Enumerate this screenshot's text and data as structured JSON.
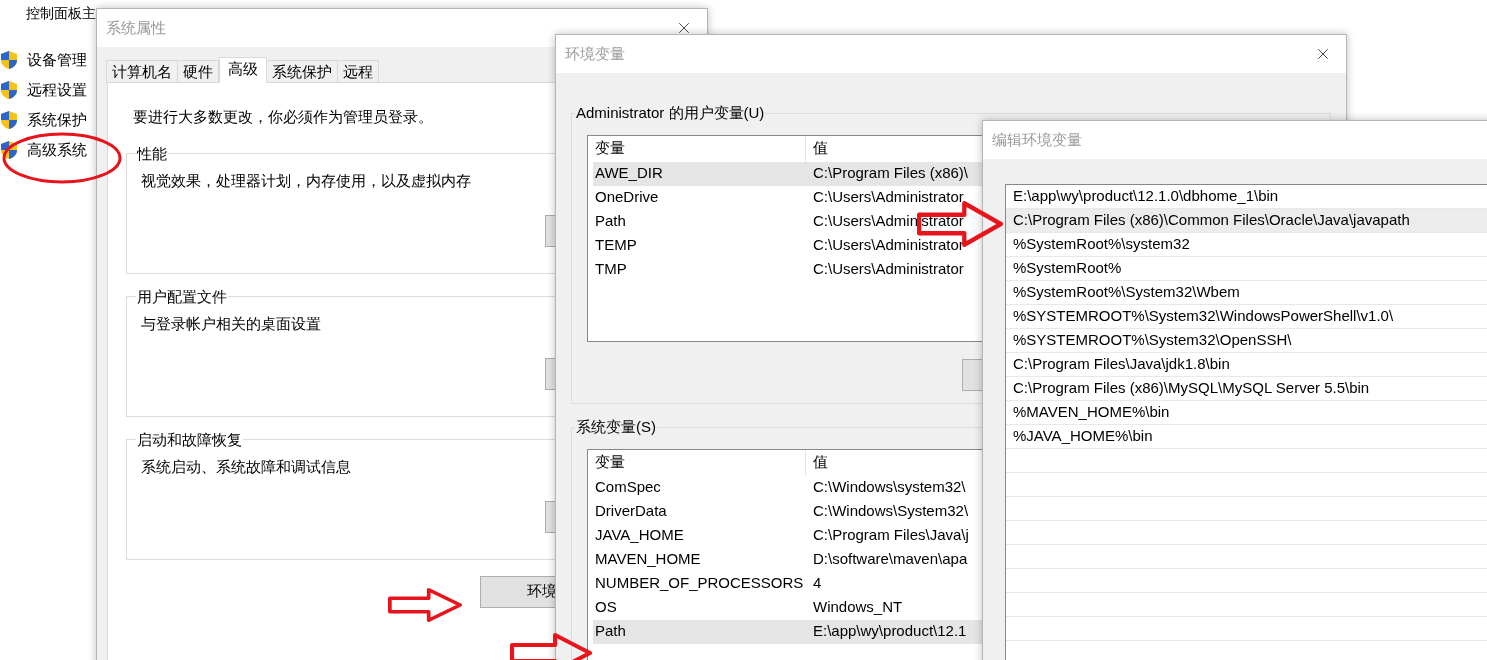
{
  "control_panel": {
    "home_link": "控制面板主",
    "items": [
      {
        "label": "设备管理"
      },
      {
        "label": "远程设置"
      },
      {
        "label": "系统保护"
      },
      {
        "label": "高级系统"
      }
    ]
  },
  "system_properties": {
    "title": "系统属性",
    "tabs": [
      {
        "label": "计算机名",
        "selected": false
      },
      {
        "label": "硬件",
        "selected": false
      },
      {
        "label": "高级",
        "selected": true
      },
      {
        "label": "系统保护",
        "selected": false
      },
      {
        "label": "远程",
        "selected": false
      }
    ],
    "notice": "要进行大多数更改，你必须作为管理员登录。",
    "groups": [
      {
        "title": "性能",
        "description": "视觉效果，处理器计划，内存使用，以及虚拟内存"
      },
      {
        "title": "用户配置文件",
        "description": "与登录帐户相关的桌面设置"
      },
      {
        "title": "启动和故障恢复",
        "description": "系统启动、系统故障和调试信息"
      }
    ],
    "env_button": "环境"
  },
  "environment_variables": {
    "title": "环境变量",
    "user_vars": {
      "title": "Administrator 的用户变量(U)",
      "columns": [
        "变量",
        "值"
      ],
      "rows": [
        {
          "name": "AWE_DIR",
          "value": "C:\\Program Files (x86)\\",
          "selected": true
        },
        {
          "name": "OneDrive",
          "value": "C:\\Users\\Administrator",
          "selected": false
        },
        {
          "name": "Path",
          "value": "C:\\Users\\Administrator",
          "selected": false
        },
        {
          "name": "TEMP",
          "value": "C:\\Users\\Administrator",
          "selected": false
        },
        {
          "name": "TMP",
          "value": "C:\\Users\\Administrator",
          "selected": false
        }
      ]
    },
    "system_vars": {
      "title": "系统变量(S)",
      "columns": [
        "变量",
        "值"
      ],
      "rows": [
        {
          "name": "ComSpec",
          "value": "C:\\Windows\\system32\\",
          "selected": false
        },
        {
          "name": "DriverData",
          "value": "C:\\Windows\\System32\\",
          "selected": false
        },
        {
          "name": "JAVA_HOME",
          "value": "C:\\Program Files\\Java\\j",
          "selected": false
        },
        {
          "name": "MAVEN_HOME",
          "value": "D:\\software\\maven\\apa",
          "selected": false
        },
        {
          "name": "NUMBER_OF_PROCESSORS",
          "value": "4",
          "selected": false
        },
        {
          "name": "OS",
          "value": "Windows_NT",
          "selected": false
        },
        {
          "name": "Path",
          "value": "E:\\app\\wy\\product\\12.1",
          "selected": true
        }
      ]
    }
  },
  "edit_env_var": {
    "title": "编辑环境变量",
    "entries": [
      {
        "text": "E:\\app\\wy\\product\\12.1.0\\dbhome_1\\bin",
        "selected": false
      },
      {
        "text": "C:\\Program Files (x86)\\Common Files\\Oracle\\Java\\javapath",
        "selected": true
      },
      {
        "text": "%SystemRoot%\\system32",
        "selected": false
      },
      {
        "text": "%SystemRoot%",
        "selected": false
      },
      {
        "text": "%SystemRoot%\\System32\\Wbem",
        "selected": false
      },
      {
        "text": "%SYSTEMROOT%\\System32\\WindowsPowerShell\\v1.0\\",
        "selected": false
      },
      {
        "text": "%SYSTEMROOT%\\System32\\OpenSSH\\",
        "selected": false
      },
      {
        "text": "C:\\Program Files\\Java\\jdk1.8\\bin",
        "selected": false
      },
      {
        "text": "C:\\Program Files (x86)\\MySQL\\MySQL Server 5.5\\bin",
        "selected": false
      },
      {
        "text": "%MAVEN_HOME%\\bin",
        "selected": false
      },
      {
        "text": "%JAVA_HOME%\\bin",
        "selected": false
      }
    ]
  }
}
